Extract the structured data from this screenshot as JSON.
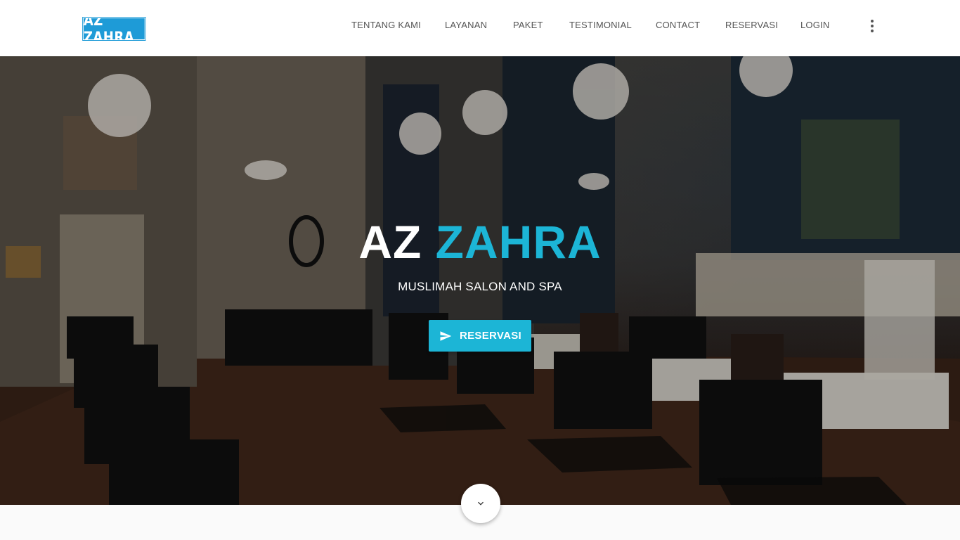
{
  "brand": {
    "logo_text": "AZ ZAHRA"
  },
  "nav": {
    "items": [
      {
        "label": "TENTANG KAMI"
      },
      {
        "label": "LAYANAN"
      },
      {
        "label": "PAKET"
      },
      {
        "label": "TESTIMONIAL"
      },
      {
        "label": "CONTACT"
      },
      {
        "label": "RESERVASI"
      },
      {
        "label": "LOGIN"
      }
    ],
    "more_icon": "more-vert-icon"
  },
  "hero": {
    "title_part1": "AZ",
    "title_part2": "ZAHRA",
    "subtitle": "MUSLIMAH SALON AND SPA",
    "cta_label": "RESERVASI",
    "cta_icon": "send-icon",
    "scroll_icon": "chevron-down-icon"
  },
  "colors": {
    "accent": "#1cb5d6",
    "logo_bg": "#1e9bd7",
    "nav_text": "#555555"
  }
}
